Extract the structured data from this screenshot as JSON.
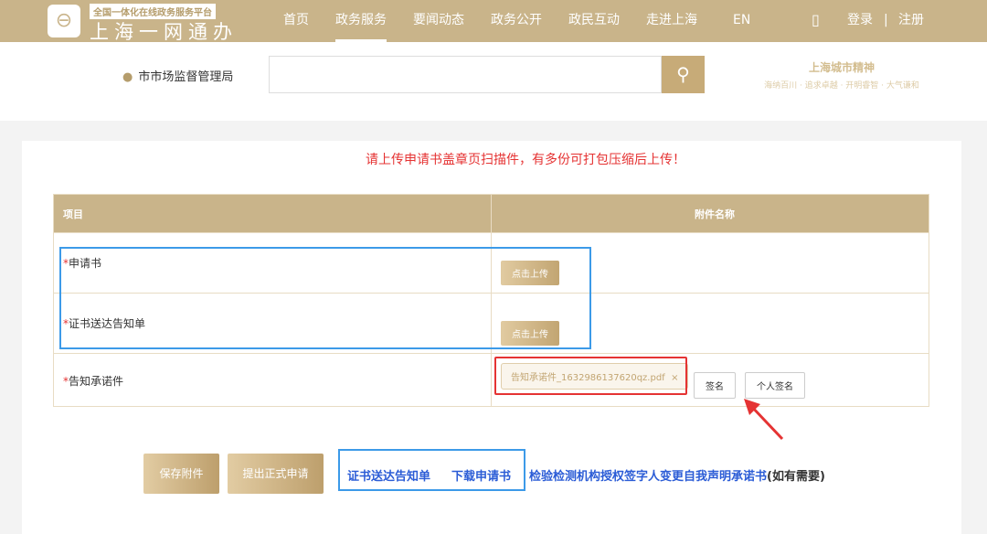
{
  "header": {
    "logo_small": "全国一体化在线政务服务平台",
    "logo_big": "上海一网通办",
    "nav": [
      "首页",
      "政务服务",
      "要闻动态",
      "政务公开",
      "政民互动",
      "走进上海",
      "EN"
    ],
    "login": "登录",
    "sep": "|",
    "register": "注册"
  },
  "subheader": {
    "location": "市市场监督管理局",
    "search_placeholder": "",
    "slogan_title": "上海城市精神",
    "slogan": "海纳百川 · 追求卓越 · 开明睿智 · 大气谦和"
  },
  "notice": "请上传申请书盖章页扫描件，有多份可打包压缩后上传！",
  "table": {
    "headers": [
      "项目",
      "附件名称"
    ],
    "rows": [
      {
        "required": "*",
        "label": "申请书",
        "button": "点击上传"
      },
      {
        "required": "*",
        "label": "证书送达告知单",
        "button": "点击上传"
      },
      {
        "required": "*",
        "label": "告知承诺件",
        "file": "告知承诺件_1632986137620qz.pdf",
        "remove": "×",
        "sign": "签名",
        "personal_sign": "个人签名"
      }
    ]
  },
  "actions": {
    "save": "保存附件",
    "submit": "提出正式申请",
    "link1": "证书送达告知单",
    "link2": "下载申请书",
    "link3": "检验检测机构授权签字人变更自我声明承诺书",
    "link3_suffix": "(如有需要)"
  }
}
